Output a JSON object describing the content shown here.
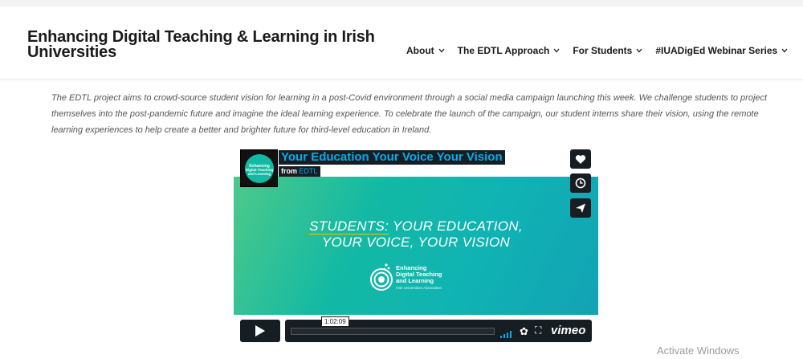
{
  "header": {
    "site_title": "Enhancing Digital Teaching & Learning in Irish Universities",
    "nav": [
      {
        "label": "About",
        "icon": "chevron-down-icon"
      },
      {
        "label": "The EDTL Approach",
        "icon": "chevron-down-icon"
      },
      {
        "label": "For Students",
        "icon": "chevron-down-icon"
      },
      {
        "label": "#IUADigEd Webinar Series",
        "icon": "chevron-down-icon"
      }
    ]
  },
  "intro": {
    "text": "The EDTL project aims to crowd-source student vision for learning in a post-Covid environment through a social media campaign launching this week. We challenge students to project themselves into the post-pandemic future and imagine the ideal learning experience. To celebrate the launch of the campaign, our student interns share their vision, using the remote learning experiences to help create a better and brighter future for third-level education in Ireland."
  },
  "video": {
    "title": "Your Education Your Voice Your Vision",
    "from_label": "from",
    "owner": "EDTL",
    "headline_keyword": "STUDENTS:",
    "headline_rest1": "YOUR EDUCATION,",
    "headline_line2": "YOUR VOICE, YOUR VISION",
    "logo_line1": "Enhancing",
    "logo_line2": "Digital Teaching",
    "logo_line3": "and Learning",
    "logo_sub": "Irish Universities Association",
    "duration": "1:02:09",
    "brand": "vimeo",
    "side_buttons": [
      "heart-icon",
      "clock-icon",
      "send-icon"
    ],
    "accent_color": "#00adef",
    "panel_color": "#161d23"
  },
  "system": {
    "watermark": "Activate Windows"
  }
}
